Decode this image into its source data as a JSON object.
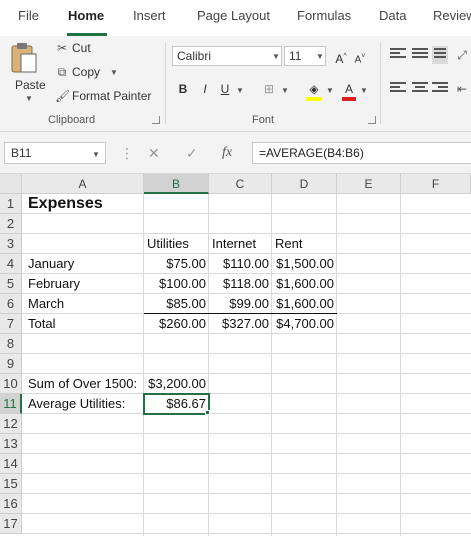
{
  "menu_tabs": [
    "File",
    "Home",
    "Insert",
    "Page Layout",
    "Formulas",
    "Data",
    "Review"
  ],
  "clipboard": {
    "paste_label": "Paste",
    "cut_label": "Cut",
    "copy_label": "Copy",
    "format_painter_label": "Format Painter",
    "group_label": "Clipboard"
  },
  "font": {
    "name": "Calibri",
    "size": "11",
    "bold": "B",
    "italic": "I",
    "underline": "U",
    "grow": "A^",
    "shrink": "A˅",
    "font_color": "A",
    "group_label": "Font",
    "font_color_hex": "#e02020",
    "highlight_hex": "#ffff00"
  },
  "formula_bar": {
    "name_box": "B11",
    "fx": "fx",
    "formula": "=AVERAGE(B4:B6)"
  },
  "columns": [
    "A",
    "B",
    "C",
    "D",
    "E",
    "F"
  ],
  "selected_column": "B",
  "rows": [
    "1",
    "2",
    "3",
    "4",
    "5",
    "6",
    "7",
    "8",
    "9",
    "10",
    "11",
    "12",
    "13",
    "14",
    "15",
    "16",
    "17"
  ],
  "selected_row": "11",
  "sheet": {
    "title": "Expenses",
    "headers": {
      "b": "Utilities",
      "c": "Internet",
      "d": "Rent"
    },
    "data_rows": [
      {
        "label": "January",
        "b": "$75.00",
        "c": "$110.00",
        "d": "$1,500.00"
      },
      {
        "label": "February",
        "b": "$100.00",
        "c": "$118.00",
        "d": "$1,600.00"
      },
      {
        "label": "March",
        "b": "$85.00",
        "c": "$99.00",
        "d": "$1,600.00"
      },
      {
        "label": "Total",
        "b": "$260.00",
        "c": "$327.00",
        "d": "$4,700.00"
      }
    ],
    "summary": [
      {
        "label": "Sum of Over 1500:",
        "value": "$3,200.00"
      },
      {
        "label": "Average Utilities:",
        "value": "$86.67"
      }
    ]
  },
  "accent_color": "#217346"
}
